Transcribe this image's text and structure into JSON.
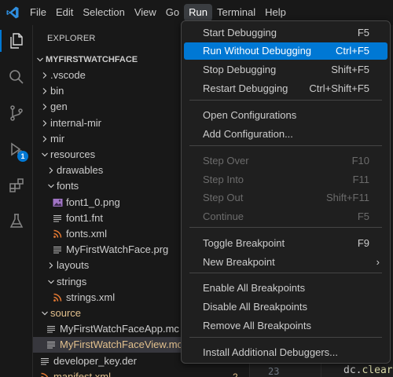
{
  "menubar": {
    "items": [
      "File",
      "Edit",
      "Selection",
      "View",
      "Go",
      "Run",
      "Terminal",
      "Help"
    ],
    "active": "Run"
  },
  "activitybar": {
    "debug_badge": "1"
  },
  "explorer": {
    "title": "EXPLORER",
    "root": "MYFIRSTWATCHFACE",
    "items": [
      {
        "label": ".vscode",
        "type": "folder",
        "expanded": false
      },
      {
        "label": "bin",
        "type": "folder",
        "expanded": false
      },
      {
        "label": "gen",
        "type": "folder",
        "expanded": false
      },
      {
        "label": "internal-mir",
        "type": "folder",
        "expanded": false
      },
      {
        "label": "mir",
        "type": "folder",
        "expanded": false
      },
      {
        "label": "resources",
        "type": "folder",
        "expanded": true
      },
      {
        "label": "drawables",
        "type": "folder",
        "expanded": false
      },
      {
        "label": "fonts",
        "type": "folder",
        "expanded": true
      },
      {
        "label": "font1_0.png",
        "type": "image"
      },
      {
        "label": "font1.fnt",
        "type": "text"
      },
      {
        "label": "fonts.xml",
        "type": "xml"
      },
      {
        "label": "MyFirstWatchFace.prg",
        "type": "text"
      },
      {
        "label": "layouts",
        "type": "folder",
        "expanded": false
      },
      {
        "label": "strings",
        "type": "folder",
        "expanded": true
      },
      {
        "label": "strings.xml",
        "type": "xml"
      },
      {
        "label": "source",
        "type": "folder",
        "expanded": true,
        "modified": true
      },
      {
        "label": "MyFirstWatchFaceApp.mc",
        "type": "text"
      },
      {
        "label": "MyFirstWatchFaceView.mc",
        "type": "text",
        "modified": true,
        "selected": true
      },
      {
        "label": "developer_key.der",
        "type": "text"
      },
      {
        "label": "manifest.xml",
        "type": "xml",
        "modified": true,
        "count": "2"
      }
    ]
  },
  "editor": {
    "line_number": "23",
    "code_prefix": "dc.",
    "code_fn": "clear("
  },
  "run_menu": {
    "items": [
      {
        "label": "Start Debugging",
        "shortcut": "F5"
      },
      {
        "label": "Run Without Debugging",
        "shortcut": "Ctrl+F5",
        "highlighted": true
      },
      {
        "label": "Stop Debugging",
        "shortcut": "Shift+F5"
      },
      {
        "label": "Restart Debugging",
        "shortcut": "Ctrl+Shift+F5"
      },
      {
        "label": "Open Configurations",
        "shortcut": ""
      },
      {
        "label": "Add Configuration...",
        "shortcut": ""
      },
      {
        "label": "Step Over",
        "shortcut": "F10",
        "disabled": true
      },
      {
        "label": "Step Into",
        "shortcut": "F11",
        "disabled": true
      },
      {
        "label": "Step Out",
        "shortcut": "Shift+F11",
        "disabled": true
      },
      {
        "label": "Continue",
        "shortcut": "F5",
        "disabled": true
      },
      {
        "label": "Toggle Breakpoint",
        "shortcut": "F9"
      },
      {
        "label": "New Breakpoint",
        "shortcut": "›",
        "submenu": true
      },
      {
        "label": "Enable All Breakpoints",
        "shortcut": ""
      },
      {
        "label": "Disable All Breakpoints",
        "shortcut": ""
      },
      {
        "label": "Remove All Breakpoints",
        "shortcut": ""
      },
      {
        "label": "Install Additional Debuggers...",
        "shortcut": ""
      }
    ]
  },
  "colors": {
    "accent": "#0078d4",
    "modified": "#e2c08d",
    "xml_icon": "#e37933",
    "image_icon": "#a074c4"
  }
}
